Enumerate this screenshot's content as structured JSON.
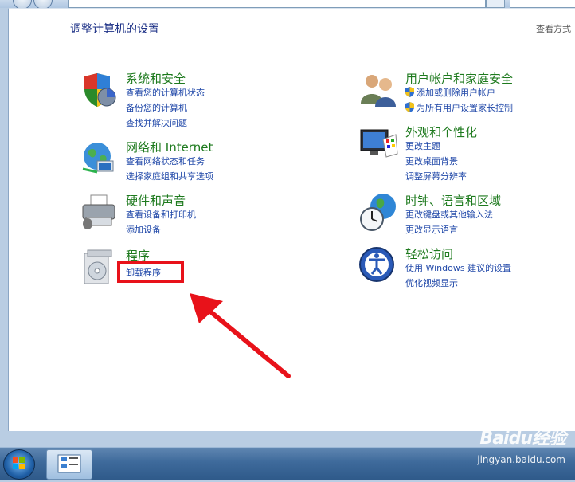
{
  "page": {
    "title": "调整计算机的设置",
    "view_by": "查看方式"
  },
  "categories": {
    "system": {
      "title": "系统和安全",
      "links": [
        "查看您的计算机状态",
        "备份您的计算机",
        "查找并解决问题"
      ]
    },
    "network": {
      "title": "网络和 Internet",
      "links": [
        "查看网络状态和任务",
        "选择家庭组和共享选项"
      ]
    },
    "hardware": {
      "title": "硬件和声音",
      "links": [
        "查看设备和打印机",
        "添加设备"
      ]
    },
    "programs": {
      "title": "程序",
      "links": [
        "卸载程序"
      ]
    },
    "users": {
      "title": "用户帐户和家庭安全",
      "links": [
        "添加或删除用户帐户",
        "为所有用户设置家长控制"
      ]
    },
    "appearance": {
      "title": "外观和个性化",
      "links": [
        "更改主题",
        "更改桌面背景",
        "调整屏幕分辨率"
      ]
    },
    "clock": {
      "title": "时钟、语言和区域",
      "links": [
        "更改键盘或其他输入法",
        "更改显示语言"
      ]
    },
    "ease": {
      "title": "轻松访问",
      "links": [
        "使用 Windows 建议的设置",
        "优化视频显示"
      ]
    }
  },
  "watermark": {
    "brand": "Baidu经验",
    "url": "jingyan.baidu.com"
  },
  "colors": {
    "category_title": "#1e7a1e",
    "link": "#1f47a8",
    "highlight": "#e8121a"
  }
}
